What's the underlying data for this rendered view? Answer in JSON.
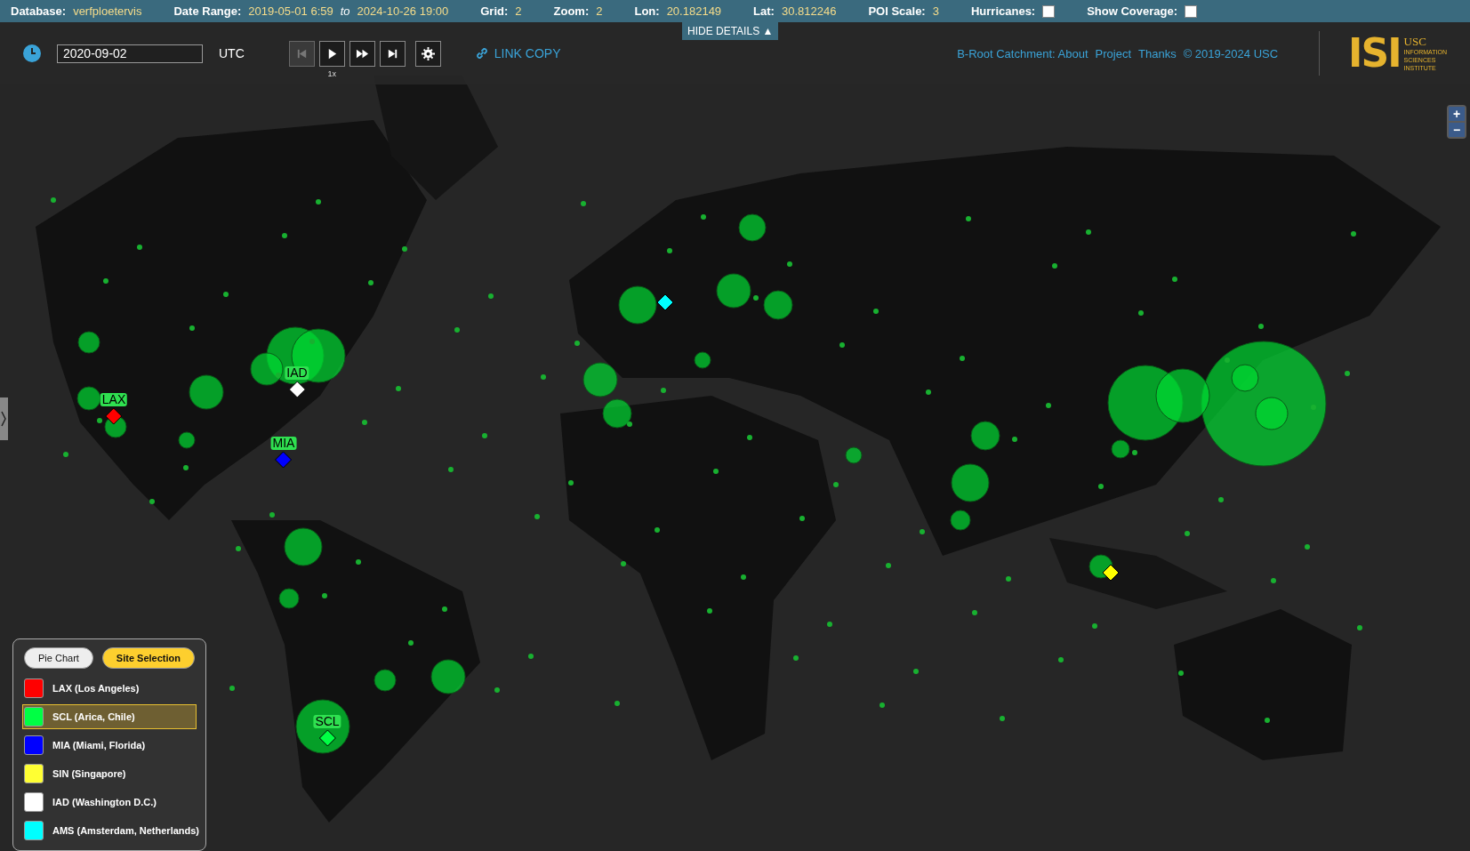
{
  "top_bar": {
    "fields": [
      {
        "label": "Database:",
        "value": "verfploetervis"
      },
      {
        "label": "Date Range:",
        "value": "2019-05-01 6:59",
        "joiner": "to",
        "value_2": "2024-10-26 19:00"
      },
      {
        "label": "Grid:",
        "value": "2"
      },
      {
        "label": "Zoom:",
        "value": "2"
      },
      {
        "label": "Lon:",
        "value": "20.182149"
      },
      {
        "label": "Lat:",
        "value": "30.812246"
      },
      {
        "label": "POI Scale:",
        "value": "3"
      }
    ],
    "checkboxes": [
      {
        "label": "Hurricanes:",
        "checked": false
      },
      {
        "label": "Show Coverage:",
        "checked": false
      }
    ]
  },
  "controls": {
    "date": "2020-09-02",
    "timezone": "UTC",
    "buttons": [
      {
        "kind": "skip-start",
        "disabled": true
      },
      {
        "kind": "play",
        "disabled": false
      },
      {
        "kind": "fast-forward",
        "disabled": false
      },
      {
        "kind": "skip-end",
        "disabled": false
      },
      {
        "kind": "settings",
        "disabled": false
      }
    ],
    "speed": "1x",
    "link_copy": "LINK COPY",
    "hide_details": "HIDE DETAILS ▲",
    "links": [
      "B-Root Catchment: About",
      "Project",
      "Thanks",
      "© 2019-2024 USC"
    ],
    "logo": {
      "mark": "ISI",
      "lines": [
        "USC",
        "INFORMATION",
        "SCIENCES",
        "INSTITUTE"
      ]
    }
  },
  "map": {
    "kind": "picture",
    "markers": [
      {
        "label": "LAX",
        "color": "#ff0000"
      },
      {
        "label": "IAD",
        "color": "#ffffff"
      },
      {
        "label": "MIA",
        "color": "#0000ff"
      },
      {
        "color": "#00ffff"
      },
      {
        "label": "SCL",
        "color": "#00ff44"
      },
      {
        "color": "#ffff00"
      }
    ],
    "zoom_buttons": [
      "+",
      "−"
    ]
  },
  "legend": {
    "tabs": [
      {
        "label": "Pie Chart",
        "selected": false
      },
      {
        "label": "Site Selection",
        "selected": true
      }
    ],
    "sites": [
      {
        "name": "LAX (Los Angeles)",
        "color": "#ff0000",
        "selected": false
      },
      {
        "name": "SCL (Arica, Chile)",
        "color": "#00ff44",
        "selected": true
      },
      {
        "name": "MIA (Miami, Florida)",
        "color": "#0000ff",
        "selected": false
      },
      {
        "name": "SIN (Singapore)",
        "color": "#ffff33",
        "selected": false
      },
      {
        "name": "IAD (Washington D.C.)",
        "color": "#ffffff",
        "selected": false
      },
      {
        "name": "AMS (Amsterdam, Netherlands)",
        "color": "#00ffff",
        "selected": false
      }
    ]
  }
}
